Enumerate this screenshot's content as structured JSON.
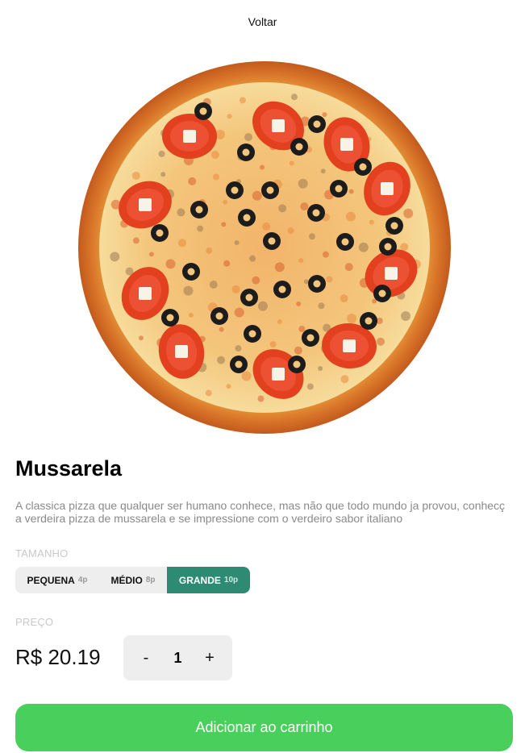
{
  "nav": {
    "back_label": "Voltar"
  },
  "product": {
    "name": "Mussarela",
    "description": "A classica pizza que qualquer ser humano conhece, mas não que todo mundo ja provou, conhecç a verdeira pizza de mussarela e se impressione com o verdeiro sabor italiano"
  },
  "size": {
    "label": "TAMANHO",
    "options": [
      {
        "name": "PEQUENA",
        "slices": "4p",
        "selected": false
      },
      {
        "name": "MÉDIO",
        "slices": "8p",
        "selected": false
      },
      {
        "name": "GRANDE",
        "slices": "10p",
        "selected": true
      }
    ]
  },
  "price": {
    "label": "PREÇO",
    "value": "R$ 20.19"
  },
  "quantity": {
    "minus": "-",
    "value": "1",
    "plus": "+"
  },
  "cart": {
    "button_label": "Adicionar ao carrinho"
  },
  "colors": {
    "accent": "#2e8b73",
    "cart_button": "#48cf5c",
    "muted_label": "#c9c9c9",
    "description": "#8a8a8a"
  }
}
